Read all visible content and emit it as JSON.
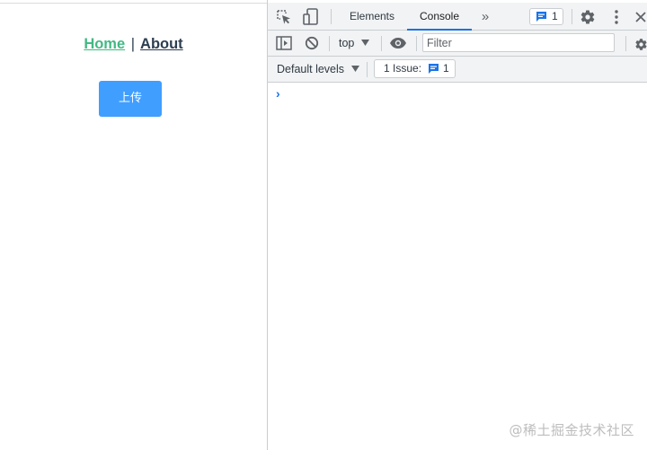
{
  "page": {
    "nav": {
      "home": "Home",
      "separator": "|",
      "about": "About"
    },
    "upload_button": "上传"
  },
  "devtools": {
    "tabs": [
      {
        "label": "Elements",
        "active": false
      },
      {
        "label": "Console",
        "active": true
      }
    ],
    "more_tabs_glyph": "»",
    "messages_badge_count": "1",
    "console_toolbar": {
      "context": "top",
      "filter_placeholder": "Filter"
    },
    "levels_toolbar": {
      "default_levels": "Default levels",
      "issues_label": "1 Issue:",
      "issues_count": "1"
    },
    "prompt_glyph": "›"
  },
  "watermark": "@稀土掘金技术社区",
  "colors": {
    "link_active": "#42b983",
    "link": "#2c3e50",
    "button_primary": "#409eff",
    "devtools_accent": "#1a73e8",
    "devtools_toolbar_bg": "#f1f3f4"
  },
  "icons": [
    "inspect-element-icon",
    "device-toolbar-icon",
    "messages-icon",
    "settings-gear-icon",
    "kebab-menu-icon",
    "close-icon",
    "sidebar-toggle-icon",
    "clear-console-icon",
    "dropdown-arrow-icon",
    "live-expression-eye-icon"
  ]
}
